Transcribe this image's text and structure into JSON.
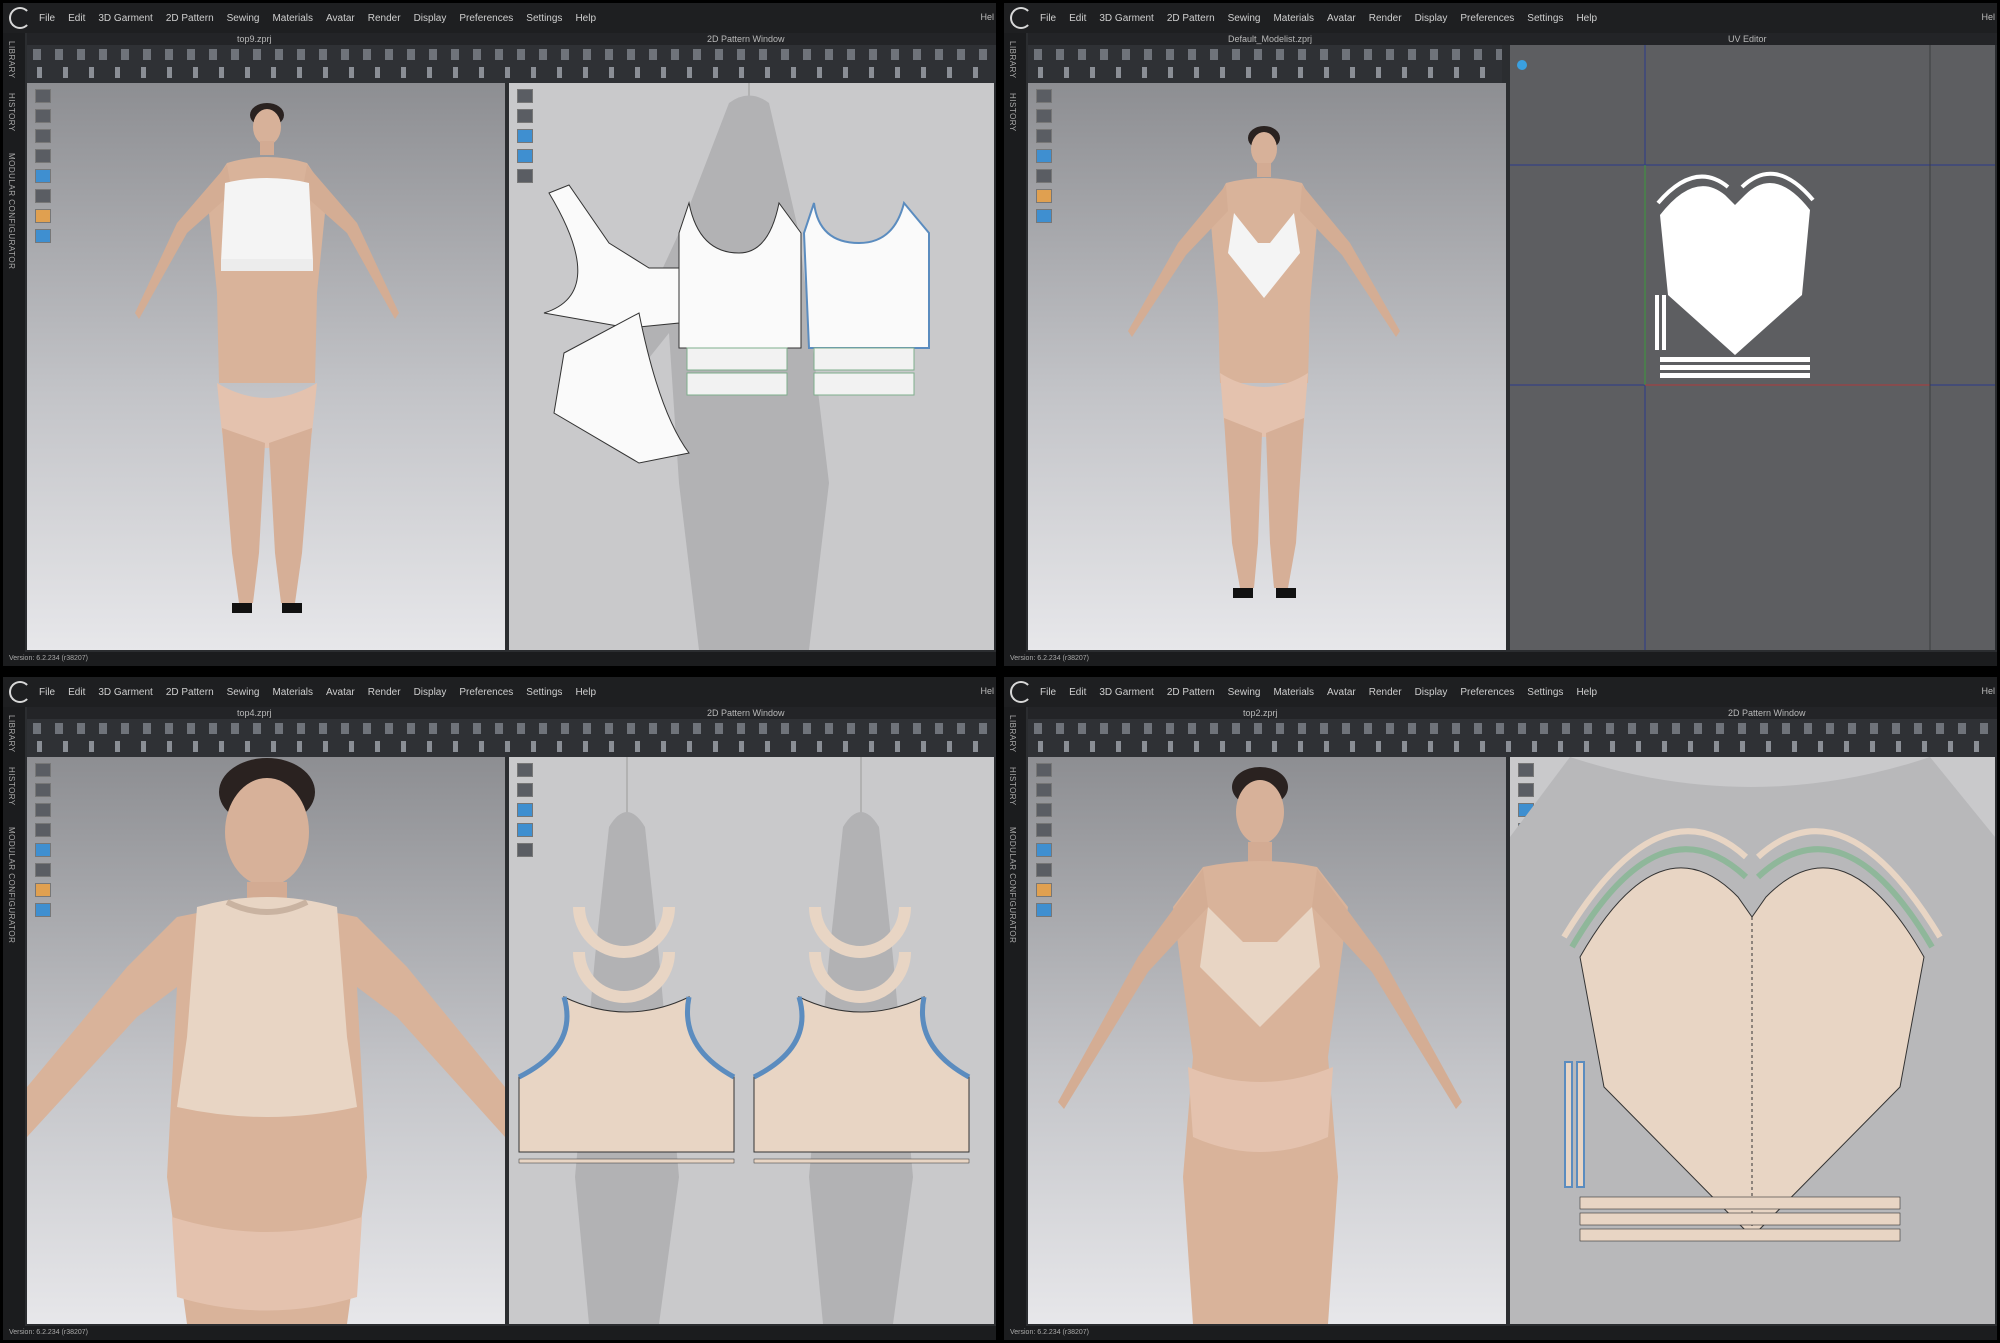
{
  "menu": [
    "File",
    "Edit",
    "3D Garment",
    "2D Pattern",
    "Sewing",
    "Materials",
    "Avatar",
    "Render",
    "Display",
    "Preferences",
    "Settings",
    "Help"
  ],
  "menu_extra": "Hel",
  "sidebar_tabs": [
    "LIBRARY",
    "HISTORY",
    "MODULAR CONFIGURATOR"
  ],
  "windows": [
    {
      "file": "top9.zprj",
      "right_title": "2D Pattern Window",
      "status": "Version: 6.2.234 (r38207)"
    },
    {
      "file": "Default_Modelist.zprj",
      "right_title": "UV Editor",
      "status": "Version: 6.2.234 (r38207)"
    },
    {
      "file": "top4.zprj",
      "right_title": "2D Pattern Window",
      "status": "Version: 6.2.234 (r38207)"
    },
    {
      "file": "top2.zprj",
      "right_title": "2D Pattern Window",
      "status": "Version: 6.2.234 (r38207)"
    }
  ],
  "colors": {
    "skin": "#d9b39a",
    "fabric_white": "#f4f4f4",
    "fabric_beige": "#e8d5c4",
    "seam_blue": "#5b8cbf",
    "seam_green": "#8fb79a"
  }
}
